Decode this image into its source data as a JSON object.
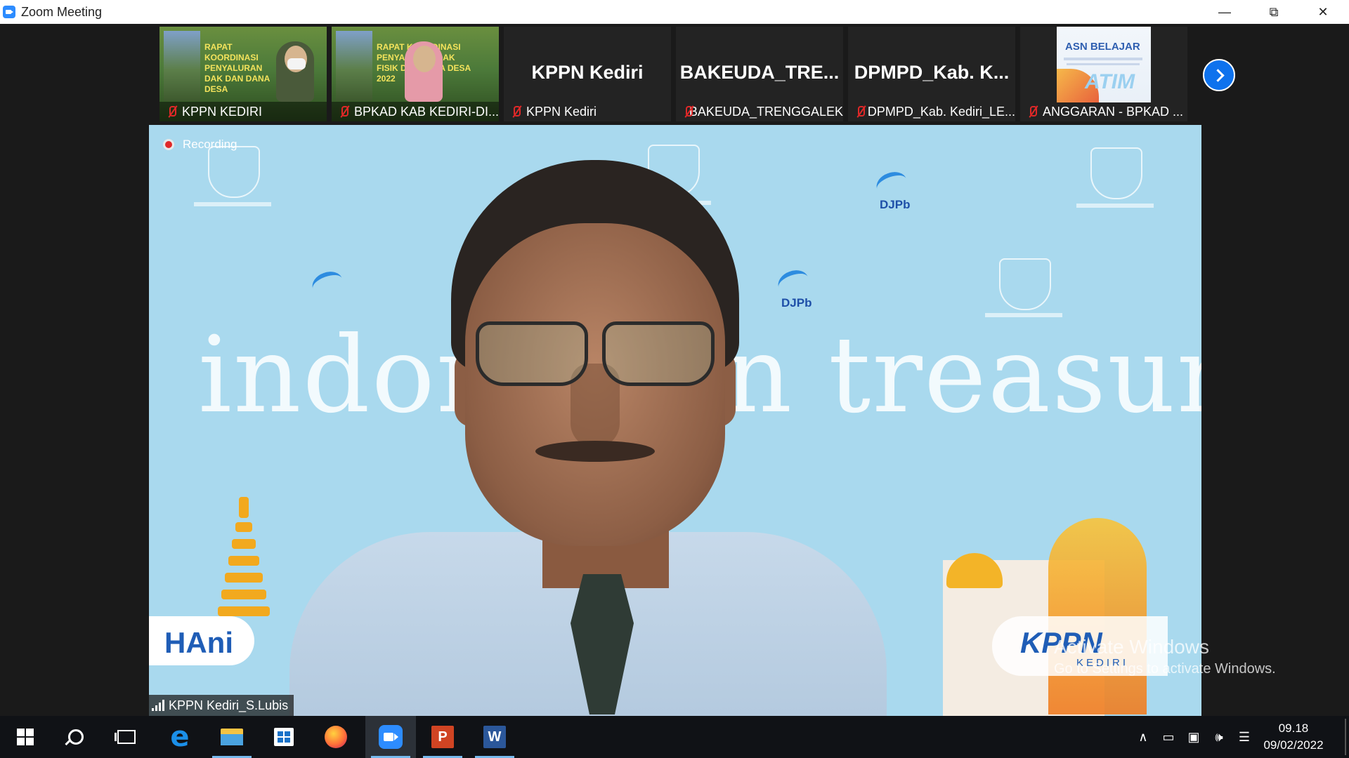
{
  "window": {
    "title": "Zoom Meeting"
  },
  "thumbnails": [
    {
      "name": "KPPN KEDIRI",
      "slide_title": "RAPAT KOORDINASI PENYALURAN DAK DAN DANA DESA"
    },
    {
      "name": "BPKAD KAB KEDIRI-DI...",
      "slide_title": "RAPAT KOORDINASI PENYALURAN DAK FISIK DAN DANA DESA 2022"
    },
    {
      "name": "KPPN Kediri",
      "big_label": "KPPN Kediri"
    },
    {
      "name": "BAKEUDA_TRENGGALEK",
      "big_label": "BAKEUDA_TRE..."
    },
    {
      "name": "DPMPD_Kab. Kediri_LE...",
      "big_label": "DPMPD_Kab.  K..."
    },
    {
      "name": "ANGGARAN - BPKAD ...",
      "image_text": "ASN BELAJAR",
      "image_sub": "ATIM"
    }
  ],
  "main_video": {
    "recording_label": "Recording",
    "speaker_name": "KPPN Kediri_S.Lubis",
    "background_text": "indonesian treasury",
    "logos": {
      "djpb": "DJPb",
      "hani": "HAni",
      "kppn": "KPPN",
      "kppn_sub": "KEDIRI"
    }
  },
  "watermark": {
    "line1": "Activate Windows",
    "line2": "Go to Settings to activate Windows."
  },
  "taskbar": {
    "apps": [
      {
        "name": "start",
        "icon": "windows-icon"
      },
      {
        "name": "search",
        "icon": "search-icon"
      },
      {
        "name": "task-view",
        "icon": "task-view-icon"
      },
      {
        "name": "edge",
        "icon": "edge-icon",
        "glyph": "e"
      },
      {
        "name": "file-explorer",
        "icon": "folder-icon"
      },
      {
        "name": "store",
        "icon": "store-icon"
      },
      {
        "name": "firefox",
        "icon": "firefox-icon"
      },
      {
        "name": "zoom",
        "icon": "zoom-icon"
      },
      {
        "name": "powerpoint",
        "icon": "powerpoint-icon",
        "glyph": "P"
      },
      {
        "name": "word",
        "icon": "word-icon",
        "glyph": "W"
      }
    ],
    "clock": {
      "time": "09.18",
      "date": "09/02/2022"
    }
  },
  "colors": {
    "zoom_blue": "#2d8cff",
    "mute_red": "#e02828",
    "stage_bg": "#a9d9ee"
  }
}
